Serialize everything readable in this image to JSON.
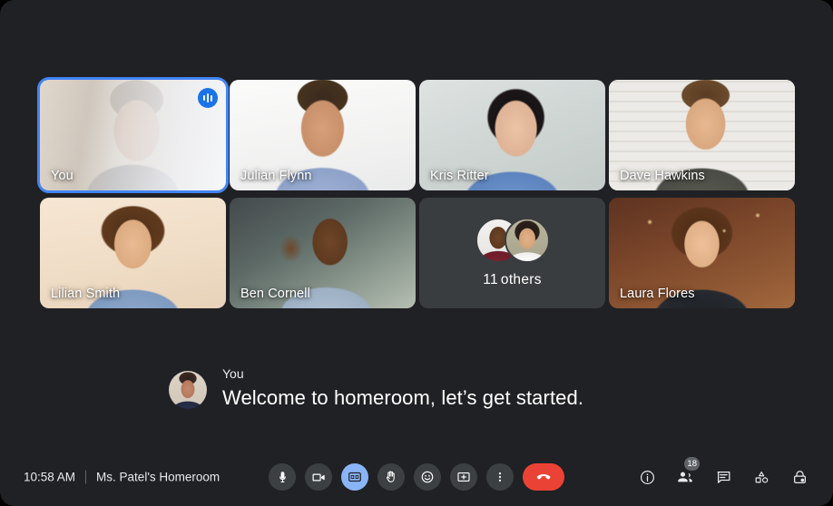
{
  "meeting": {
    "time": "10:58 AM",
    "room_name": "Ms. Patel's Homeroom"
  },
  "grid": {
    "tiles": [
      {
        "name": "You",
        "type": "video",
        "active_speaker": true,
        "audio_indicator": "audio-level-icon"
      },
      {
        "name": "Julian Flynn",
        "type": "video",
        "active_speaker": false
      },
      {
        "name": "Kris Ritter",
        "type": "video",
        "active_speaker": false
      },
      {
        "name": "Dave Hawkins",
        "type": "video",
        "active_speaker": false
      },
      {
        "name": "Lilian Smith",
        "type": "video",
        "active_speaker": false
      },
      {
        "name": "Ben Cornell",
        "type": "video",
        "active_speaker": false
      },
      {
        "name": "11 others",
        "type": "overflow",
        "count": "11",
        "suffix": "others"
      },
      {
        "name": "Laura Flores",
        "type": "video",
        "active_speaker": false
      }
    ]
  },
  "caption": {
    "speaker": "You",
    "text": "Welcome to homeroom, let’s get started."
  },
  "controls": {
    "items": [
      {
        "id": "microphone",
        "label": "Turn off microphone",
        "icon": "microphone-icon",
        "active": false
      },
      {
        "id": "camera",
        "label": "Turn off camera",
        "icon": "video-camera-icon",
        "active": false
      },
      {
        "id": "captions",
        "label": "Turn off captions",
        "icon": "closed-captions-icon",
        "active": true
      },
      {
        "id": "raise-hand",
        "label": "Raise hand",
        "icon": "raised-hand-icon",
        "active": false
      },
      {
        "id": "reactions",
        "label": "Send a reaction",
        "icon": "smiley-face-icon",
        "active": false
      },
      {
        "id": "present",
        "label": "Present now",
        "icon": "present-screen-icon",
        "active": false
      },
      {
        "id": "more-options",
        "label": "More options",
        "icon": "three-dots-vertical-icon",
        "active": false
      },
      {
        "id": "end-call",
        "label": "Leave call",
        "icon": "phone-hangup-icon",
        "active": false
      }
    ]
  },
  "right_controls": {
    "items": [
      {
        "id": "meeting-details",
        "label": "Meeting details",
        "icon": "info-circle-icon",
        "badge": ""
      },
      {
        "id": "people",
        "label": "Show everyone",
        "icon": "people-icon",
        "badge": "18"
      },
      {
        "id": "chat",
        "label": "Chat with everyone",
        "icon": "chat-bubble-icon",
        "badge": ""
      },
      {
        "id": "activities",
        "label": "Activities",
        "icon": "shapes-activities-icon",
        "badge": ""
      },
      {
        "id": "host-controls",
        "label": "Host controls",
        "icon": "lock-shield-icon",
        "badge": ""
      }
    ]
  },
  "colors": {
    "background": "#202124",
    "tile_placeholder": "#3c4043",
    "accent_blue": "#1a73e8",
    "active_control": "#8ab4f8",
    "end_call_red": "#ea4335",
    "active_speaker_border": "#4285f4"
  }
}
